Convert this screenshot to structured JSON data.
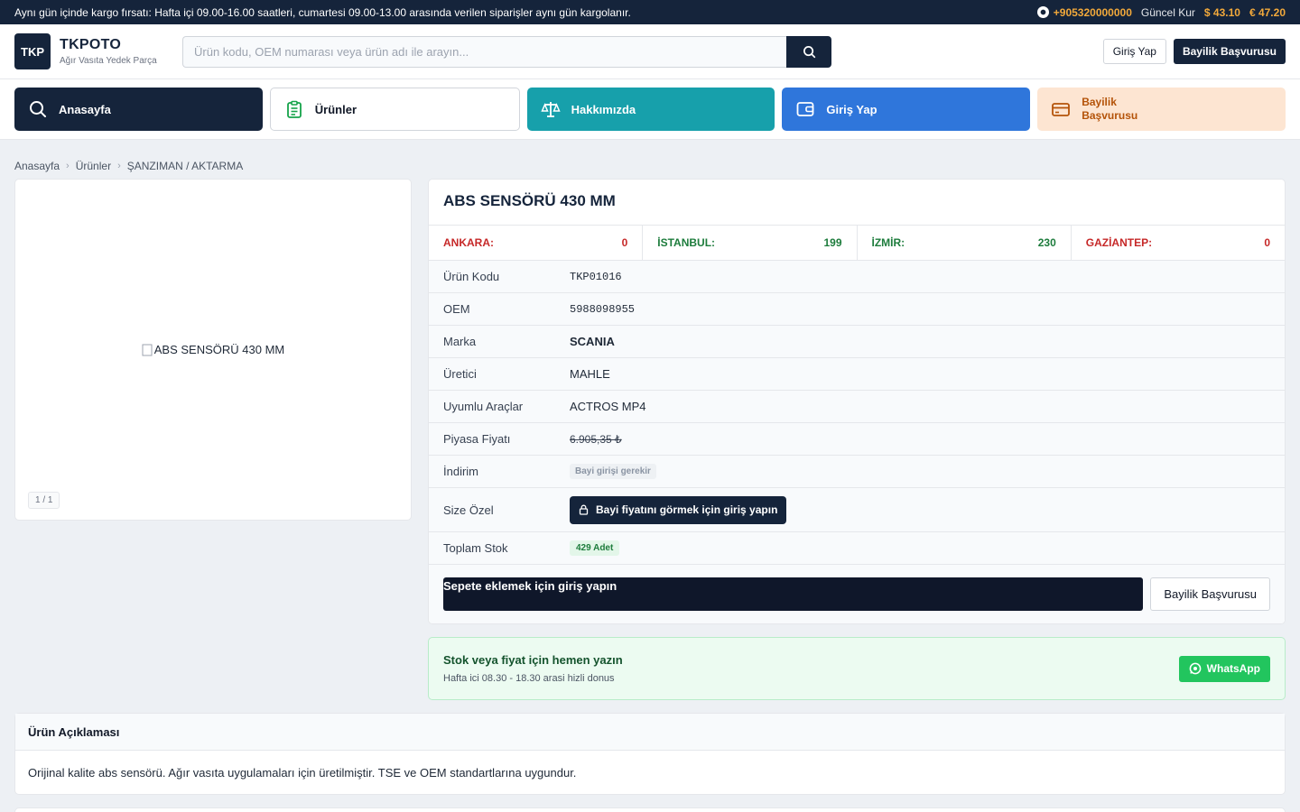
{
  "topbar": {
    "notice": "Aynı gün içinde kargo fırsatı: Hafta içi 09.00-16.00 saatleri, cumartesi 09.00-13.00 arasında verilen siparişler aynı gün kargolanır.",
    "phone": "+905320000000",
    "rates_label": "Güncel Kur",
    "usd": "$ 43.10",
    "eur": "€ 47.20"
  },
  "header": {
    "logo_mark": "TKP",
    "brand": "TKPOTO",
    "tagline": "Ağır Vasıta Yedek Parça",
    "search_placeholder": "Ürün kodu, OEM numarası veya ürün adı ile arayın...",
    "login": "Giriş Yap",
    "dealer": "Bayilik Başvurusu"
  },
  "nav": {
    "home": "Anasayfa",
    "products": "Ürünler",
    "about": "Hakkımızda",
    "login": "Giriş Yap",
    "dealer_line1": "Bayilik",
    "dealer_line2": "Başvurusu"
  },
  "breadcrumb": [
    "Anasayfa",
    "Ürünler",
    "ŞANZIMAN / AKTARMA"
  ],
  "gallery": {
    "alt": "ABS SENSÖRÜ 430 MM",
    "counter": "1 / 1"
  },
  "product": {
    "title": "ABS SENSÖRÜ 430 MM",
    "stocks": [
      {
        "city": "ANKARA:",
        "qty": "0",
        "status": "red"
      },
      {
        "city": "İSTANBUL:",
        "qty": "199",
        "status": "green"
      },
      {
        "city": "İZMİR:",
        "qty": "230",
        "status": "green"
      },
      {
        "city": "GAZİANTEP:",
        "qty": "0",
        "status": "red"
      }
    ],
    "rows": {
      "code_label": "Ürün Kodu",
      "code": "TKP01016",
      "oem_label": "OEM",
      "oem": "5988098955",
      "brand_label": "Marka",
      "brand": "SCANIA",
      "maker_label": "Üretici",
      "maker": "MAHLE",
      "fit_label": "Uyumlu Araçlar",
      "fit": "ACTROS MP4",
      "market_label": "Piyasa Fiyatı",
      "market": "6.905,35 ₺",
      "discount_label": "İndirim",
      "discount": "Bayi girişi gerekir",
      "special_label": "Size Özel",
      "special_btn": "Bayi fiyatını görmek için giriş yapın",
      "total_label": "Toplam Stok",
      "total": "429 Adet"
    },
    "cart_btn": "Sepete eklemek için giriş yapın",
    "dealer_btn": "Bayilik Başvurusu"
  },
  "contact": {
    "heading": "Stok veya fiyat için hemen yazın",
    "sub": "Hafta ici 08.30 - 18.30 arasi hizli donus",
    "whatsapp": "WhatsApp"
  },
  "description": {
    "heading": "Ürün Açıklaması",
    "body": "Orijinal kalite abs sensörü. Ağır vasıta uygulamaları için üretilmiştir. TSE ve OEM standartlarına uygundur."
  },
  "colors": {
    "navy": "#15243b",
    "teal": "#17a0ab",
    "blue": "#2f76db",
    "peach": "#fde5d2",
    "accent_orange": "#f2a93b",
    "whatsapp_green": "#22c55e"
  }
}
